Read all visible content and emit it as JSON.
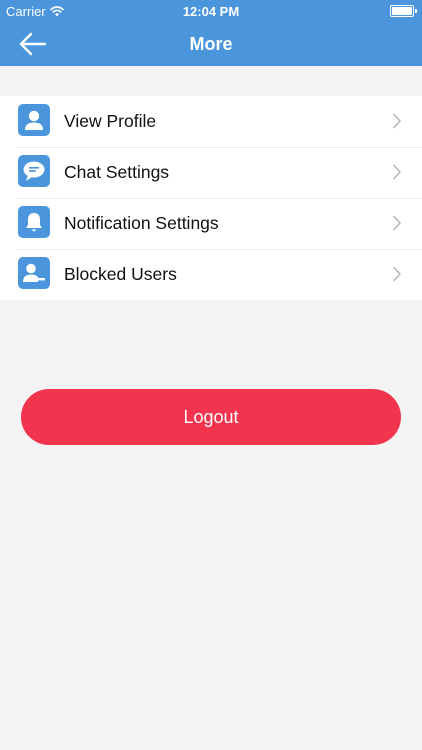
{
  "status_bar": {
    "carrier": "Carrier",
    "time": "12:04 PM",
    "wifi_icon": "wifi-icon",
    "battery_icon": "battery-icon",
    "battery_level": 1.0
  },
  "nav": {
    "title": "More",
    "back_icon": "back-arrow-icon"
  },
  "menu": {
    "items": [
      {
        "label": "View Profile",
        "icon": "user-icon"
      },
      {
        "label": "Chat Settings",
        "icon": "chat-bubble-icon"
      },
      {
        "label": "Notification Settings",
        "icon": "bell-icon"
      },
      {
        "label": "Blocked Users",
        "icon": "blocked-user-icon"
      }
    ]
  },
  "logout": {
    "label": "Logout"
  },
  "colors": {
    "primary": "#4a95dc",
    "logout": "#f2344e",
    "background": "#f4f4f5",
    "text": "#111111"
  }
}
